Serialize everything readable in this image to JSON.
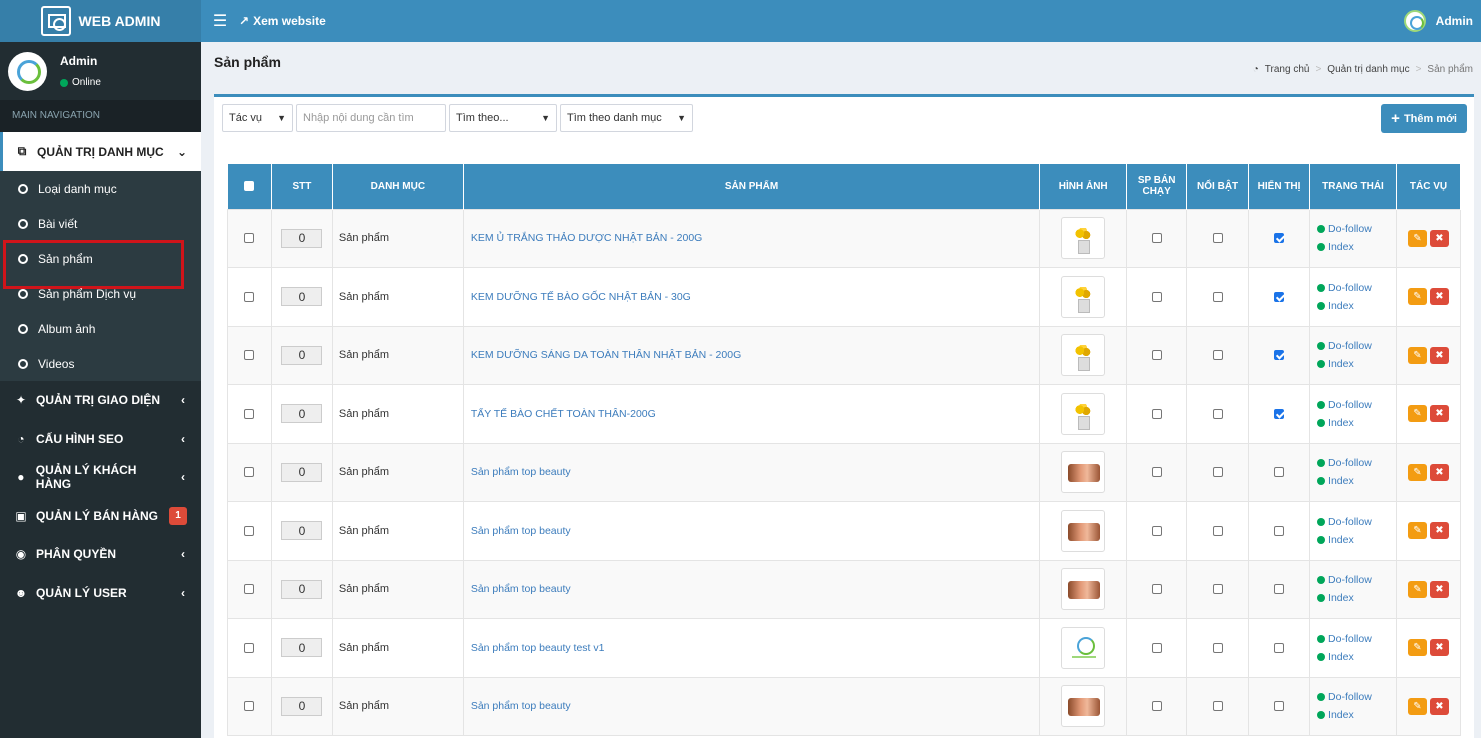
{
  "header": {
    "brand": "WEB ADMIN",
    "view_site": "Xem website",
    "user": "Admin"
  },
  "sidebar": {
    "user_name": "Admin",
    "user_status": "Online",
    "nav_header": "MAIN NAVIGATION",
    "active_menu": "QUẢN TRỊ DANH MỤC",
    "sub_items": [
      "Loại danh mục",
      "Bài viết",
      "Sản phẩm",
      "Sản phẩm Dịch vụ",
      "Album ảnh",
      "Videos"
    ],
    "menu_items": [
      {
        "label": "QUẢN TRỊ GIAO DIỆN",
        "icon": "magic-wand-icon"
      },
      {
        "label": "CẤU HÌNH SEO",
        "icon": "dashboard-icon"
      },
      {
        "label": "QUẢN LÝ KHÁCH HÀNG",
        "icon": "users-icon"
      },
      {
        "label": "QUẢN LÝ BÁN HÀNG",
        "icon": "money-icon",
        "badge": "1"
      },
      {
        "label": "PHÂN QUYỀN",
        "icon": "lock-icon"
      },
      {
        "label": "QUẢN LÝ USER",
        "icon": "user-icon"
      }
    ]
  },
  "page": {
    "title": "Sản phẩm",
    "breadcrumb": [
      "Trang chủ",
      "Quản trị danh mục",
      "Sản phẩm"
    ]
  },
  "toolbar": {
    "action_select": "Tác vụ",
    "search_placeholder": "Nhập nội dung cần tìm",
    "search_by": "Tìm theo...",
    "search_category": "Tìm theo danh mục",
    "add_button": "Thêm mới"
  },
  "table": {
    "headers": [
      "STT",
      "DANH MỤC",
      "SẢN PHẨM",
      "HÌNH ẢNH",
      "SP BÁN CHẠY",
      "NỔI BẬT",
      "HIỂN THỊ",
      "TRẠNG THÁI",
      "TÁC VỤ"
    ],
    "rows": [
      {
        "stt": "0",
        "category": "Sản phẩm",
        "product": "KEM Ủ TRẮNG THẢO DƯỢC NHẬT BẢN - 200G",
        "image": "flower",
        "bestseller": false,
        "featured": false,
        "visible": true,
        "follow": "Do-follow",
        "index": "Index"
      },
      {
        "stt": "0",
        "category": "Sản phẩm",
        "product": "KEM DƯỠNG TẾ BÀO GỐC NHẬT BẢN - 30G",
        "image": "flower",
        "bestseller": false,
        "featured": false,
        "visible": true,
        "follow": "Do-follow",
        "index": "Index"
      },
      {
        "stt": "0",
        "category": "Sản phẩm",
        "product": "KEM DƯỠNG SÁNG DA TOÀN THÂN NHẬT BẢN - 200G",
        "image": "flower",
        "bestseller": false,
        "featured": false,
        "visible": true,
        "follow": "Do-follow",
        "index": "Index"
      },
      {
        "stt": "0",
        "category": "Sản phẩm",
        "product": "TẨY TẾ BÀO CHẾT TOÀN THÂN-200G",
        "image": "flower",
        "bestseller": false,
        "featured": false,
        "visible": true,
        "follow": "Do-follow",
        "index": "Index"
      },
      {
        "stt": "0",
        "category": "Sản phẩm",
        "product": "Sản phẩm top beauty",
        "image": "face",
        "bestseller": false,
        "featured": false,
        "visible": false,
        "follow": "Do-follow",
        "index": "Index"
      },
      {
        "stt": "0",
        "category": "Sản phẩm",
        "product": "Sản phẩm top beauty",
        "image": "face",
        "bestseller": false,
        "featured": false,
        "visible": false,
        "follow": "Do-follow",
        "index": "Index"
      },
      {
        "stt": "0",
        "category": "Sản phẩm",
        "product": "Sản phẩm top beauty",
        "image": "face",
        "bestseller": false,
        "featured": false,
        "visible": false,
        "follow": "Do-follow",
        "index": "Index"
      },
      {
        "stt": "0",
        "category": "Sản phẩm",
        "product": "Sản phẩm top beauty test v1",
        "image": "logo",
        "bestseller": false,
        "featured": false,
        "visible": false,
        "follow": "Do-follow",
        "index": "Index"
      },
      {
        "stt": "0",
        "category": "Sản phẩm",
        "product": "Sản phẩm top beauty",
        "image": "face",
        "bestseller": false,
        "featured": false,
        "visible": false,
        "follow": "Do-follow",
        "index": "Index"
      }
    ]
  },
  "colors": {
    "header": "#3c8dbc",
    "sidebar": "#222d32",
    "highlight_box": "#d0141a",
    "edit": "#f39c12",
    "delete": "#dd4b39"
  }
}
